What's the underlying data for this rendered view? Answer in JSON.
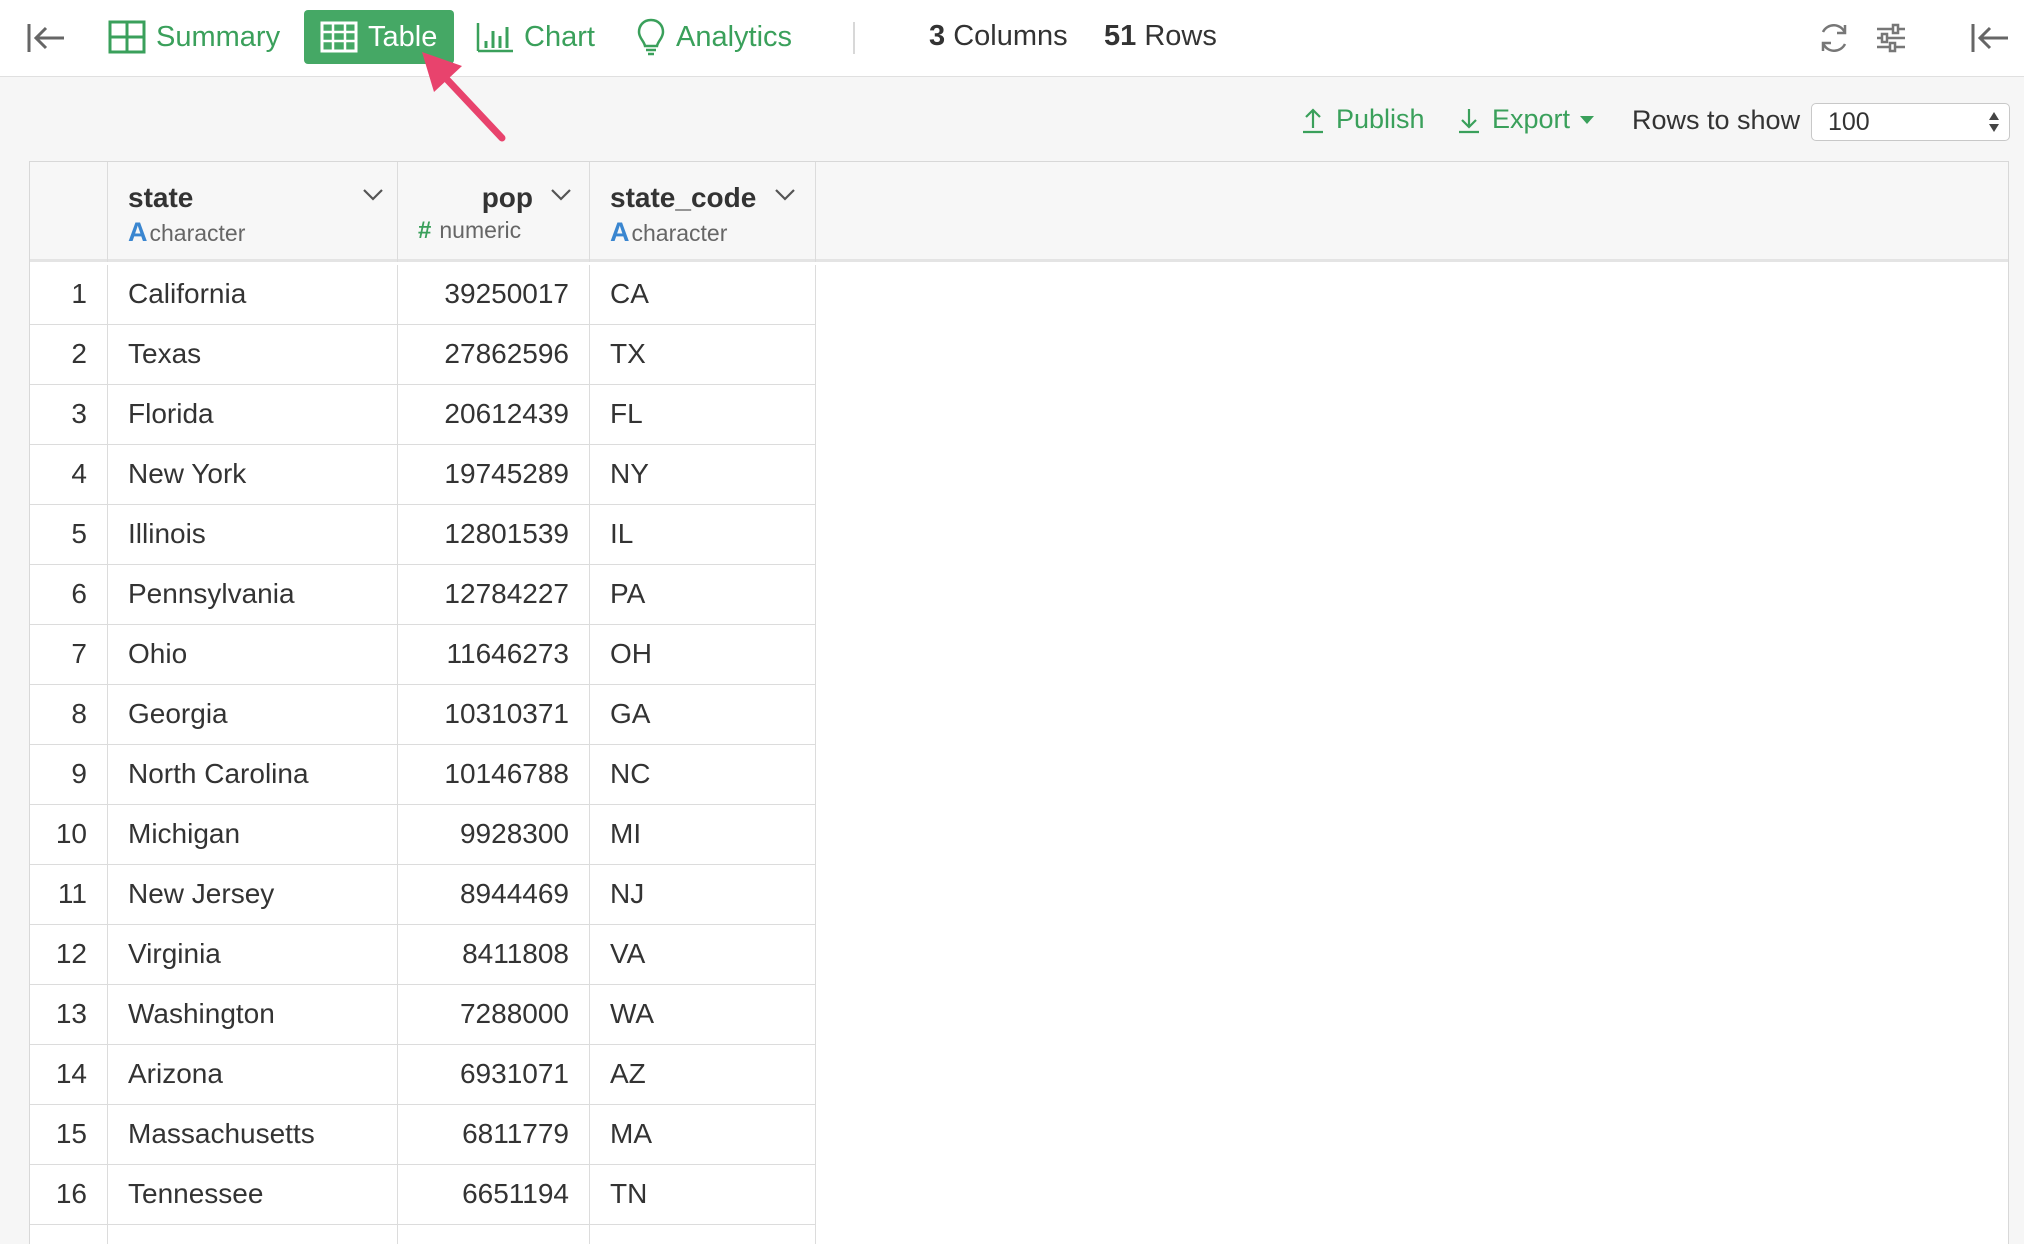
{
  "toolbar": {
    "tabs": [
      {
        "label": "Summary",
        "icon": "grid-icon"
      },
      {
        "label": "Table",
        "icon": "table-icon",
        "active": true
      },
      {
        "label": "Chart",
        "icon": "bar-chart-icon"
      },
      {
        "label": "Analytics",
        "icon": "lightbulb-icon"
      }
    ],
    "columns_count": "3",
    "columns_label": "Columns",
    "rows_count": "51",
    "rows_label": "Rows"
  },
  "actions": {
    "publish_label": "Publish",
    "export_label": "Export",
    "rows_to_show_label": "Rows to show",
    "rows_to_show_value": "100"
  },
  "colors": {
    "accent": "#45a865",
    "accent_text": "#3aa05b",
    "type_character": "#3a86d0",
    "pointer_arrow": "#e8436d"
  },
  "table": {
    "columns": [
      {
        "name": "state",
        "type_glyph": "A",
        "type": "character"
      },
      {
        "name": "pop",
        "type_glyph": "#",
        "type": "numeric"
      },
      {
        "name": "state_code",
        "type_glyph": "A",
        "type": "character"
      }
    ],
    "rows": [
      {
        "n": "1",
        "state": "California",
        "pop": "39250017",
        "code": "CA"
      },
      {
        "n": "2",
        "state": "Texas",
        "pop": "27862596",
        "code": "TX"
      },
      {
        "n": "3",
        "state": "Florida",
        "pop": "20612439",
        "code": "FL"
      },
      {
        "n": "4",
        "state": "New York",
        "pop": "19745289",
        "code": "NY"
      },
      {
        "n": "5",
        "state": "Illinois",
        "pop": "12801539",
        "code": "IL"
      },
      {
        "n": "6",
        "state": "Pennsylvania",
        "pop": "12784227",
        "code": "PA"
      },
      {
        "n": "7",
        "state": "Ohio",
        "pop": "11646273",
        "code": "OH"
      },
      {
        "n": "8",
        "state": "Georgia",
        "pop": "10310371",
        "code": "GA"
      },
      {
        "n": "9",
        "state": "North Carolina",
        "pop": "10146788",
        "code": "NC"
      },
      {
        "n": "10",
        "state": "Michigan",
        "pop": "9928300",
        "code": "MI"
      },
      {
        "n": "11",
        "state": "New Jersey",
        "pop": "8944469",
        "code": "NJ"
      },
      {
        "n": "12",
        "state": "Virginia",
        "pop": "8411808",
        "code": "VA"
      },
      {
        "n": "13",
        "state": "Washington",
        "pop": "7288000",
        "code": "WA"
      },
      {
        "n": "14",
        "state": "Arizona",
        "pop": "6931071",
        "code": "AZ"
      },
      {
        "n": "15",
        "state": "Massachusetts",
        "pop": "6811779",
        "code": "MA"
      },
      {
        "n": "16",
        "state": "Tennessee",
        "pop": "6651194",
        "code": "TN"
      }
    ]
  }
}
